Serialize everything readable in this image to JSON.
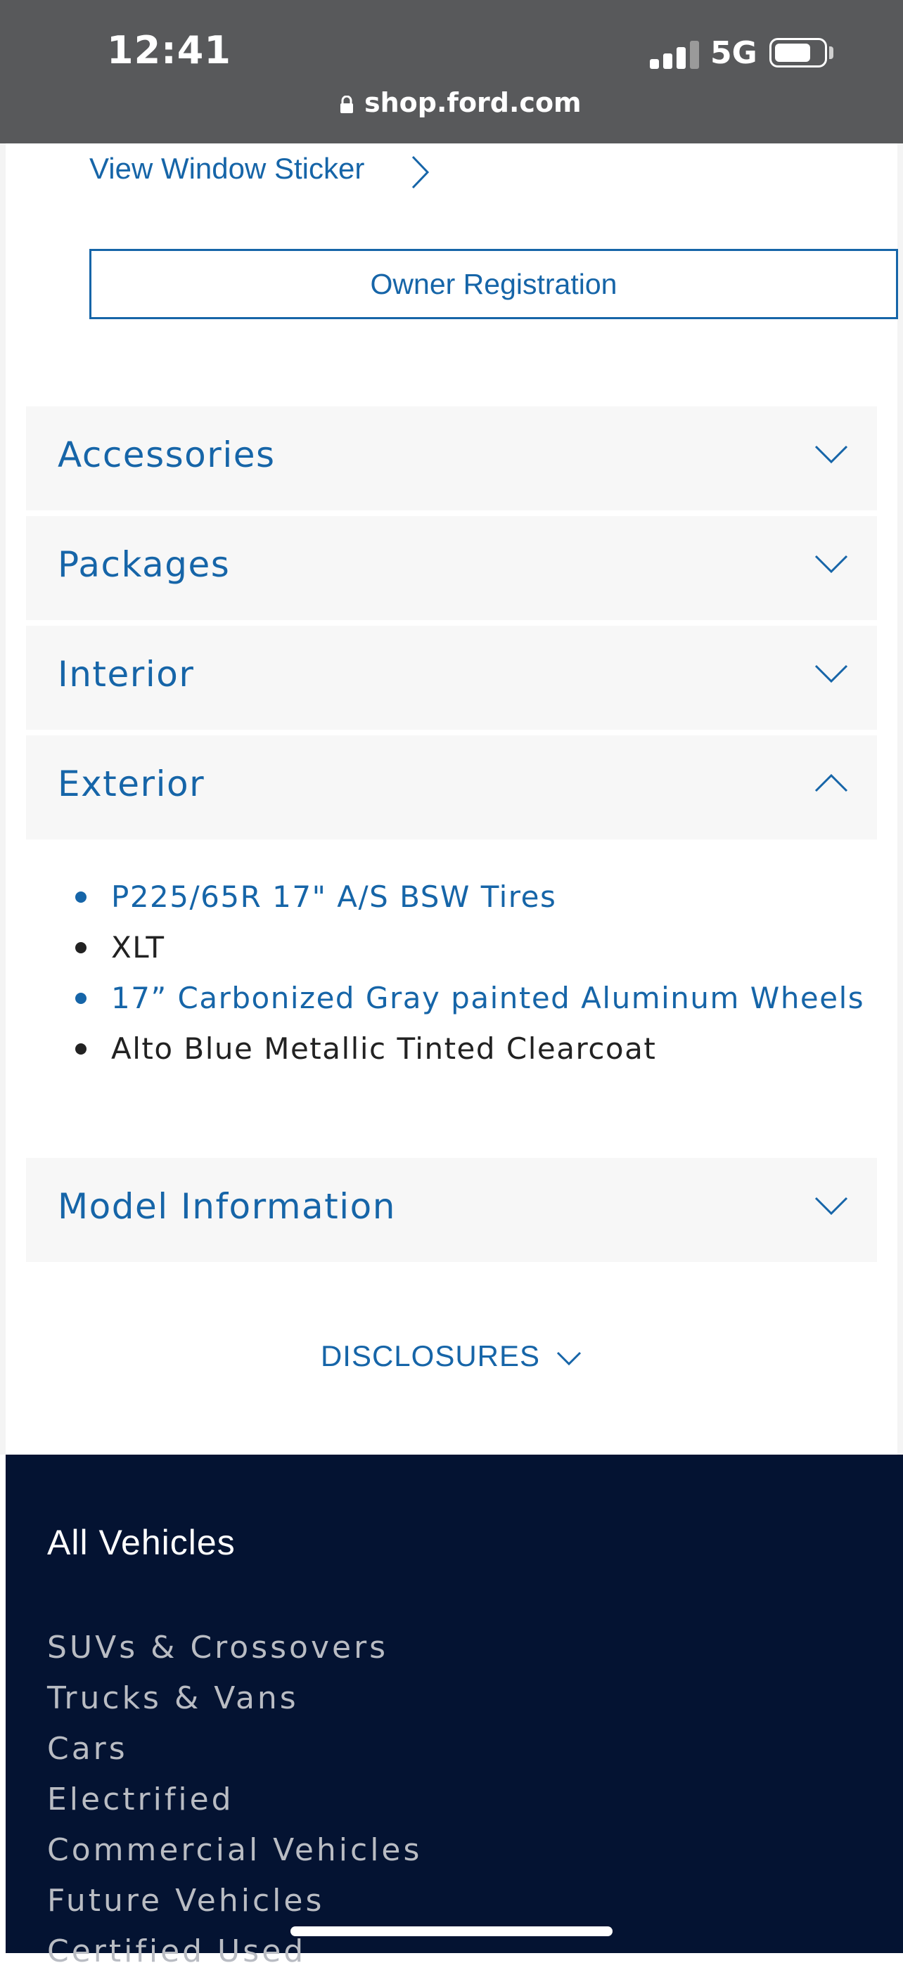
{
  "status_bar": {
    "time": "12:41",
    "network": "5G",
    "url": "shop.ford.com"
  },
  "links": {
    "window_sticker": "View Window Sticker",
    "owner_registration": "Owner Registration"
  },
  "accordions": [
    {
      "label": "Accessories",
      "expanded": false
    },
    {
      "label": "Packages",
      "expanded": false
    },
    {
      "label": "Interior",
      "expanded": false
    },
    {
      "label": "Exterior",
      "expanded": true
    },
    {
      "label": "Model Information",
      "expanded": false
    }
  ],
  "exterior_items": [
    {
      "text": "P225/65R 17\" A/S BSW Tires",
      "link": true
    },
    {
      "text": "XLT",
      "link": false
    },
    {
      "text": "17” Carbonized Gray painted Aluminum Wheels",
      "link": true
    },
    {
      "text": "Alto Blue Metallic Tinted Clearcoat",
      "link": false
    }
  ],
  "disclosures_label": "DISCLOSURES",
  "footer": {
    "title": "All Vehicles",
    "items": [
      "SUVs & Crossovers",
      "Trucks & Vans",
      "Cars",
      "Electrified",
      "Commercial Vehicles",
      "Future Vehicles",
      "Certified Used"
    ]
  },
  "colors": {
    "status_bar": "#58595b",
    "link_blue": "#1665a8",
    "footer_bg": "#041332"
  },
  "icons": [
    "lock-icon",
    "signal-icon",
    "battery-icon",
    "chevron-right-icon",
    "chevron-down-icon",
    "chevron-up-icon"
  ]
}
